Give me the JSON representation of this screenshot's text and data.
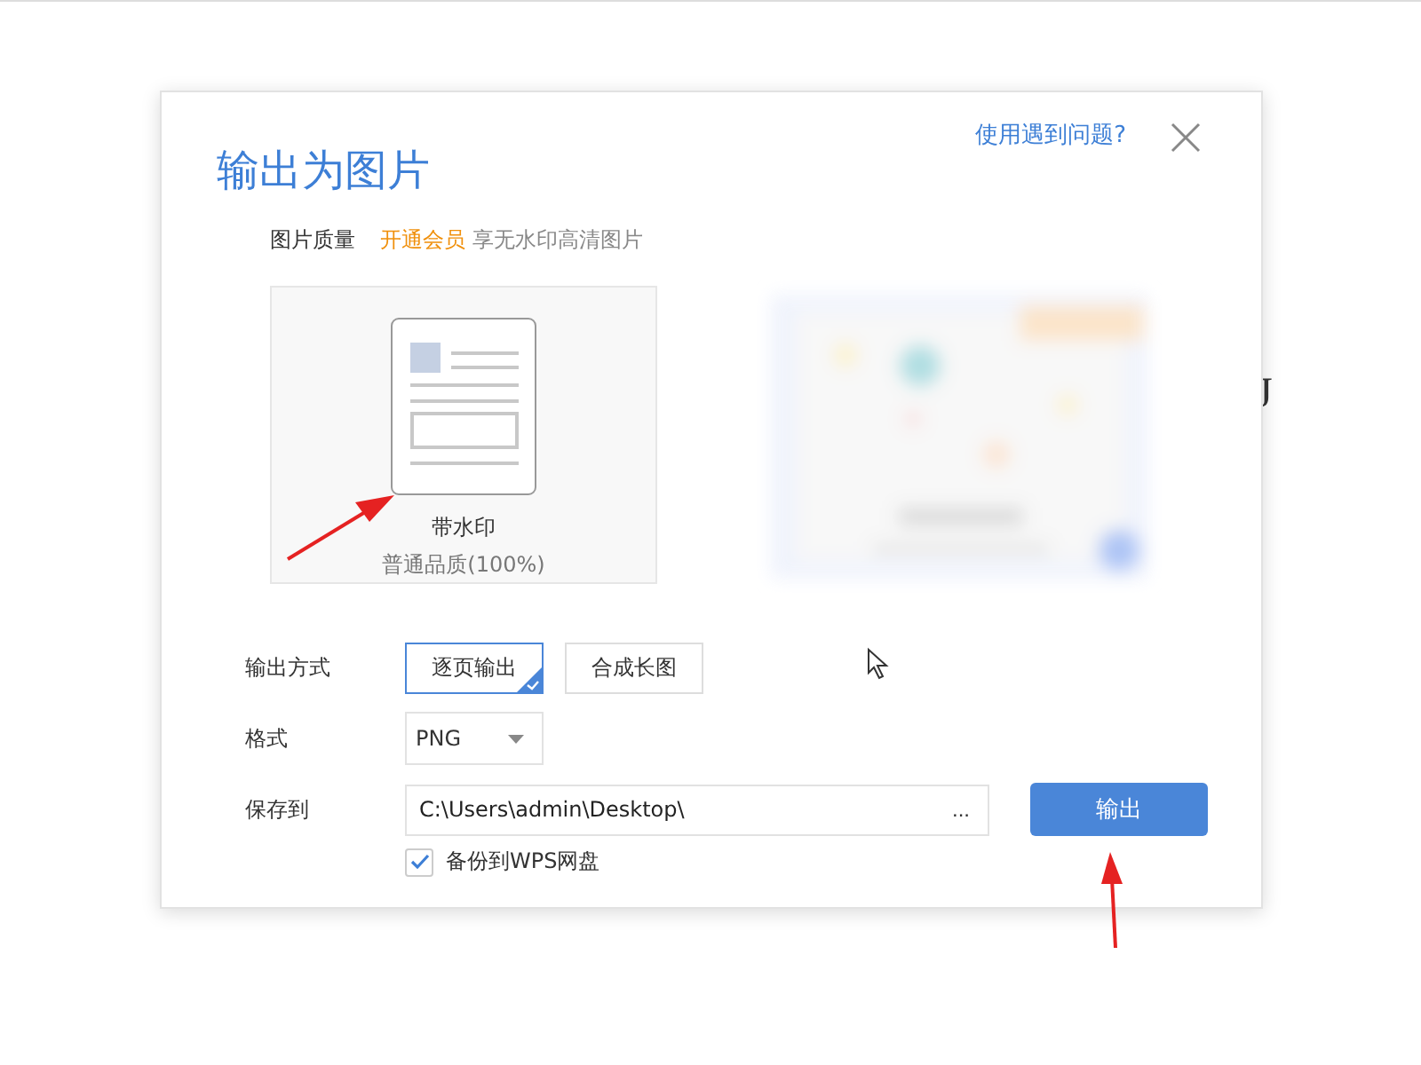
{
  "background_text": "J",
  "dialog": {
    "title": "输出为图片",
    "help_link": "使用遇到问题?"
  },
  "quality": {
    "label": "图片质量",
    "vip_link": "开通会员",
    "vip_hint": "享无水印高清图片",
    "options": [
      {
        "kind": "watermark",
        "title": "带水印",
        "subtitle": "普通品质(100%)",
        "selected": true
      },
      {
        "kind": "preview",
        "selected": false
      }
    ]
  },
  "output_mode": {
    "label": "输出方式",
    "options": [
      {
        "label": "逐页输出",
        "selected": true
      },
      {
        "label": "合成长图",
        "selected": false
      }
    ]
  },
  "format": {
    "label": "格式",
    "value": "PNG"
  },
  "save_to": {
    "label": "保存到",
    "value": "C:\\Users\\admin\\Desktop\\",
    "browse": "...",
    "button": "输出"
  },
  "backup": {
    "label": "备份到WPS网盘",
    "checked": true
  }
}
